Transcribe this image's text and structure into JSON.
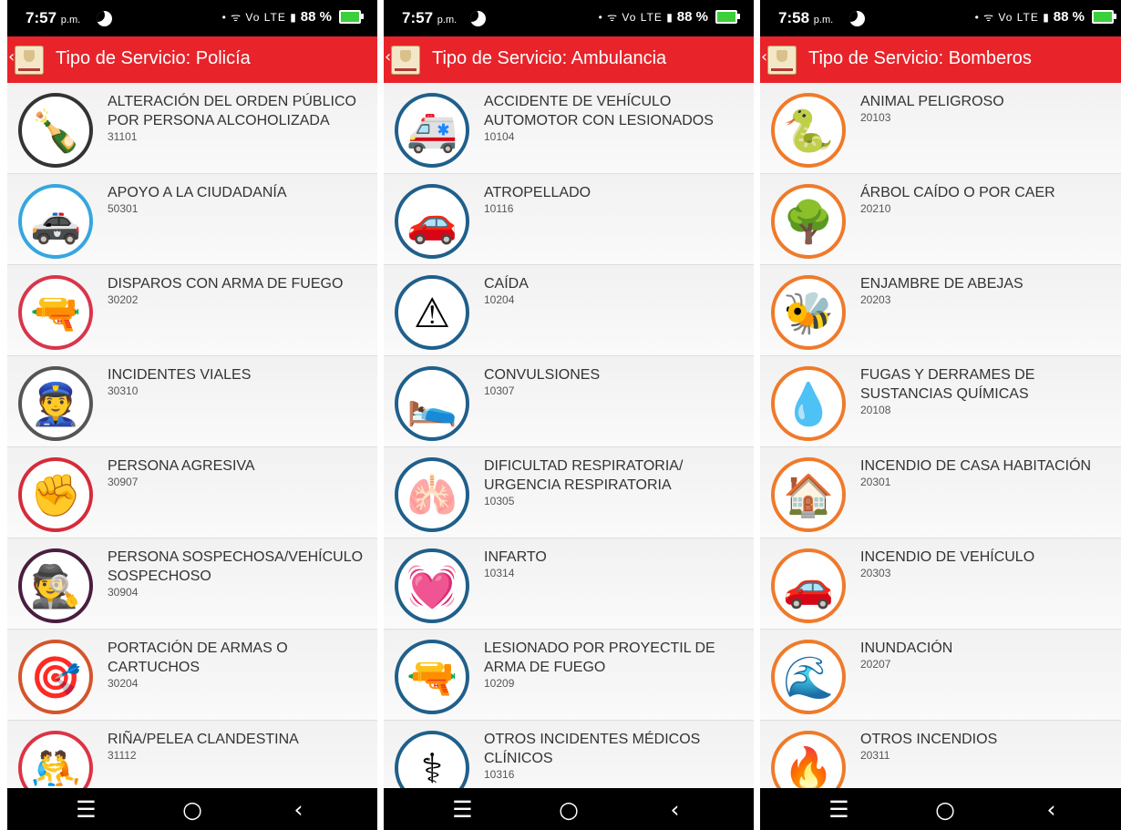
{
  "screens": [
    {
      "status_time": "7:57",
      "status_ampm": "p.m.",
      "status_battery": "88 %",
      "title": "Tipo de Servicio: Policía",
      "accent": "#e8232a",
      "items": [
        {
          "label": "ALTERACIÓN DEL ORDEN PÚBLICO POR PERSONA ALCOHOLIZADA",
          "code": "31101",
          "icon": "drunk-person-icon",
          "glyph": "🍾",
          "color": "#333333"
        },
        {
          "label": "APOYO A LA CIUDADANÍA",
          "code": "50301",
          "icon": "police-car-icon",
          "glyph": "🚓",
          "color": "#36a6df"
        },
        {
          "label": "DISPAROS CON ARMA DE FUEGO",
          "code": "30202",
          "icon": "gun-firing-icon",
          "glyph": "🔫",
          "color": "#d9354b"
        },
        {
          "label": "INCIDENTES VIALES",
          "code": "30310",
          "icon": "traffic-officer-icon",
          "glyph": "👮",
          "color": "#555555"
        },
        {
          "label": "PERSONA AGRESIVA",
          "code": "30907",
          "icon": "fist-icon",
          "glyph": "✊",
          "color": "#d62b3a"
        },
        {
          "label": "PERSONA SOSPECHOSA/VEHÍCULO SOSPECHOSO",
          "code": "30904",
          "icon": "suspect-icon",
          "glyph": "🕵",
          "color": "#4a1d3f"
        },
        {
          "label": "PORTACIÓN DE ARMAS O CARTUCHOS",
          "code": "30204",
          "icon": "armed-person-icon",
          "glyph": "🎯",
          "color": "#d4552a"
        },
        {
          "label": "RIÑA/PELEA CLANDESTINA",
          "code": "31112",
          "icon": "fight-icon",
          "glyph": "🤼",
          "color": "#dd3344"
        }
      ]
    },
    {
      "status_time": "7:57",
      "status_ampm": "p.m.",
      "status_battery": "88 %",
      "title": "Tipo de Servicio: Ambulancia",
      "accent": "#e8232a",
      "items": [
        {
          "label": "ACCIDENTE DE VEHÍCULO AUTOMOTOR CON LESIONADOS",
          "code": "10104",
          "icon": "injured-vehicle-icon",
          "glyph": "🚑",
          "color": "#1f5f8b"
        },
        {
          "label": "ATROPELLADO",
          "code": "10116",
          "icon": "pedestrian-hit-icon",
          "glyph": "🚗",
          "color": "#1f5f8b"
        },
        {
          "label": "CAÍDA",
          "code": "10204",
          "icon": "fall-icon",
          "glyph": "⚠",
          "color": "#1f5f8b"
        },
        {
          "label": "CONVULSIONES",
          "code": "10307",
          "icon": "seizure-icon",
          "glyph": "🛌",
          "color": "#1f5f8b"
        },
        {
          "label": "DIFICULTAD RESPIRATORIA/ URGENCIA RESPIRATORIA",
          "code": "10305",
          "icon": "lungs-icon",
          "glyph": "🫁",
          "color": "#1f5f8b"
        },
        {
          "label": "INFARTO",
          "code": "10314",
          "icon": "heart-attack-icon",
          "glyph": "💓",
          "color": "#1f5f8b"
        },
        {
          "label": "LESIONADO POR PROYECTIL DE ARMA DE FUEGO",
          "code": "10209",
          "icon": "pistol-icon",
          "glyph": "🔫",
          "color": "#1f5f8b"
        },
        {
          "label": "OTROS INCIDENTES MÉDICOS CLÍNICOS",
          "code": "10316",
          "icon": "caduceus-icon",
          "glyph": "⚕",
          "color": "#1f5f8b"
        }
      ]
    },
    {
      "status_time": "7:58",
      "status_ampm": "p.m.",
      "status_battery": "88 %",
      "title": "Tipo de Servicio: Bomberos",
      "accent": "#e8232a",
      "items": [
        {
          "label": "ANIMAL PELIGROSO",
          "code": "20103",
          "icon": "snake-icon",
          "glyph": "🐍",
          "color": "#f07a2a"
        },
        {
          "label": "ÁRBOL CAÍDO O POR CAER",
          "code": "20210",
          "icon": "fallen-tree-icon",
          "glyph": "🌳",
          "color": "#f07a2a"
        },
        {
          "label": "ENJAMBRE DE ABEJAS",
          "code": "20203",
          "icon": "beehive-icon",
          "glyph": "🐝",
          "color": "#f07a2a"
        },
        {
          "label": "FUGAS Y DERRAMES DE SUSTANCIAS QUÍMICAS",
          "code": "20108",
          "icon": "chemical-leak-icon",
          "glyph": "💧",
          "color": "#f07a2a"
        },
        {
          "label": "INCENDIO DE CASA HABITACIÓN",
          "code": "20301",
          "icon": "house-fire-icon",
          "glyph": "🏠",
          "color": "#f07a2a"
        },
        {
          "label": "INCENDIO DE VEHÍCULO",
          "code": "20303",
          "icon": "vehicle-fire-icon",
          "glyph": "🚗",
          "color": "#f07a2a"
        },
        {
          "label": "INUNDACIÓN",
          "code": "20207",
          "icon": "flood-icon",
          "glyph": "🌊",
          "color": "#f07a2a"
        },
        {
          "label": "OTROS INCENDIOS",
          "code": "20311",
          "icon": "fire-icon",
          "glyph": "🔥",
          "color": "#f07a2a"
        }
      ]
    }
  ]
}
